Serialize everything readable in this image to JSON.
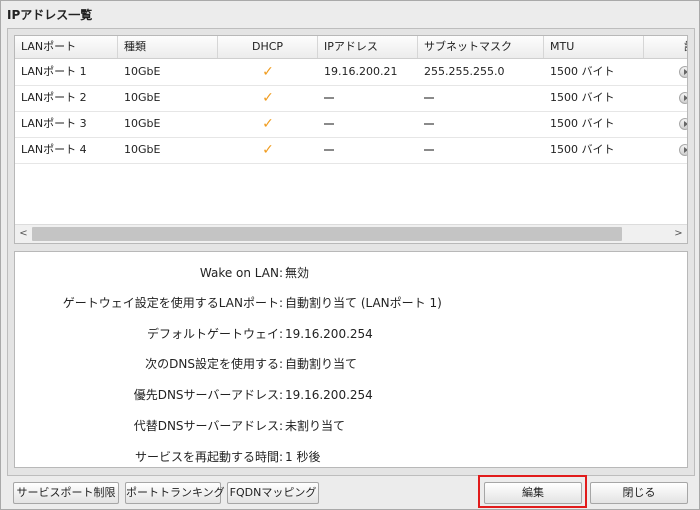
{
  "dialog": {
    "title": "IPアドレス一覧"
  },
  "table": {
    "headers": [
      "LANポート",
      "種類",
      "DHCP",
      "IPアドレス",
      "サブネットマスク",
      "MTU",
      "詳細"
    ],
    "rows": [
      {
        "port": "LANポート 1",
        "type": "10GbE",
        "dhcp": "✓",
        "ip": "19.16.200.21",
        "mask": "255.255.255.0",
        "mtu": "1500 バイト"
      },
      {
        "port": "LANポート 2",
        "type": "10GbE",
        "dhcp": "✓",
        "ip": "",
        "mask": "",
        "mtu": "1500 バイト"
      },
      {
        "port": "LANポート 3",
        "type": "10GbE",
        "dhcp": "✓",
        "ip": "",
        "mask": "",
        "mtu": "1500 バイト"
      },
      {
        "port": "LANポート 4",
        "type": "10GbE",
        "dhcp": "✓",
        "ip": "",
        "mask": "",
        "mtu": "1500 バイト"
      }
    ],
    "scroll_left": "<",
    "scroll_right": ">"
  },
  "details": {
    "items": [
      {
        "label": "Wake on LAN:",
        "value": "無効"
      },
      {
        "label": "ゲートウェイ設定を使用するLANポート:",
        "value": "自動割り当て (LANポート 1)"
      },
      {
        "label": "デフォルトゲートウェイ:",
        "value": "19.16.200.254"
      },
      {
        "label": "次のDNS設定を使用する:",
        "value": "自動割り当て"
      },
      {
        "label": "優先DNSサーバーアドレス:",
        "value": "19.16.200.254"
      },
      {
        "label": "代替DNSサーバーアドレス:",
        "value": "未割り当て"
      },
      {
        "label": "サービスを再起動する時間:",
        "value": "1 秒後"
      }
    ]
  },
  "footer": {
    "service_port": "サービスポート制限",
    "port_trunking": "ポートトランキング",
    "fqdn_mapping": "FQDNマッピング",
    "edit": "編集",
    "close": "閉じる"
  },
  "colors": {
    "check": "#f09c1f",
    "highlight": "#e11b1b"
  }
}
